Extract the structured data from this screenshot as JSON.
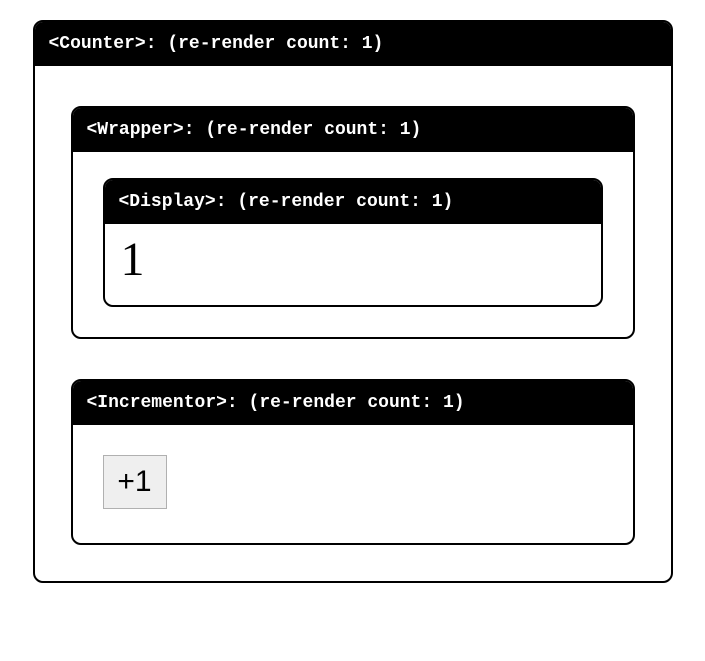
{
  "counter": {
    "header": "<Counter>: (re-render count: 1)"
  },
  "wrapper": {
    "header": "<Wrapper>: (re-render count: 1)"
  },
  "display": {
    "header": "<Display>: (re-render count: 1)",
    "value": "1"
  },
  "incrementor": {
    "header": "<Incrementor>: (re-render count: 1)",
    "button_label": "+1"
  }
}
